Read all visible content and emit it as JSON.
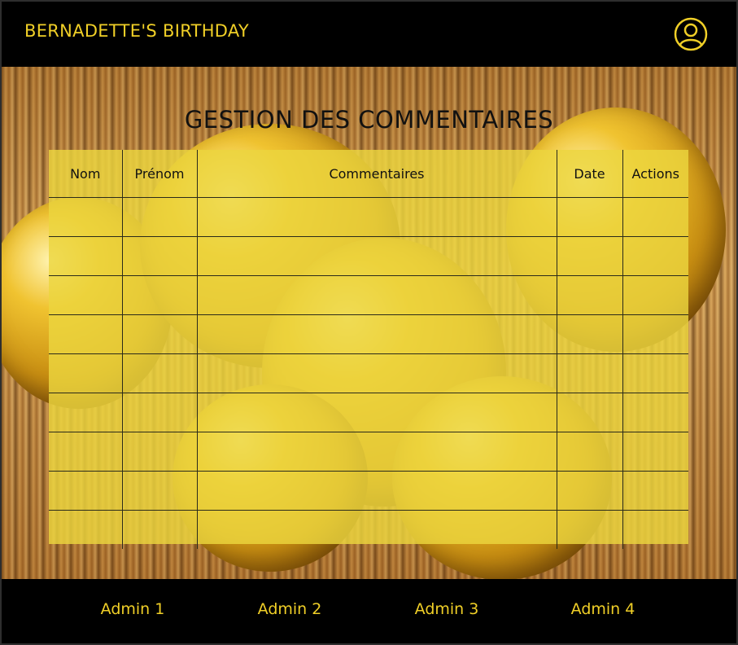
{
  "header": {
    "site_title": "BERNADETTE'S BIRTHDAY",
    "profile_icon": "user-circle-icon"
  },
  "main": {
    "title": "GESTION DES COMMENTAIRES",
    "table": {
      "columns": [
        "Nom",
        "Prénom",
        "Commentaires",
        "Date",
        "Actions"
      ],
      "rows": [
        [
          "",
          "",
          "",
          "",
          ""
        ],
        [
          "",
          "",
          "",
          "",
          ""
        ],
        [
          "",
          "",
          "",
          "",
          ""
        ],
        [
          "",
          "",
          "",
          "",
          ""
        ],
        [
          "",
          "",
          "",
          "",
          ""
        ],
        [
          "",
          "",
          "",
          "",
          ""
        ],
        [
          "",
          "",
          "",
          "",
          ""
        ],
        [
          "",
          "",
          "",
          "",
          ""
        ],
        [
          "",
          "",
          "",
          "",
          ""
        ]
      ]
    }
  },
  "footer": {
    "nav": [
      "Admin 1",
      "Admin 2",
      "Admin 3",
      "Admin 4"
    ]
  },
  "colors": {
    "accent": "#f0cf27",
    "bar_background": "#000000",
    "table_background": "#ecd63e"
  }
}
